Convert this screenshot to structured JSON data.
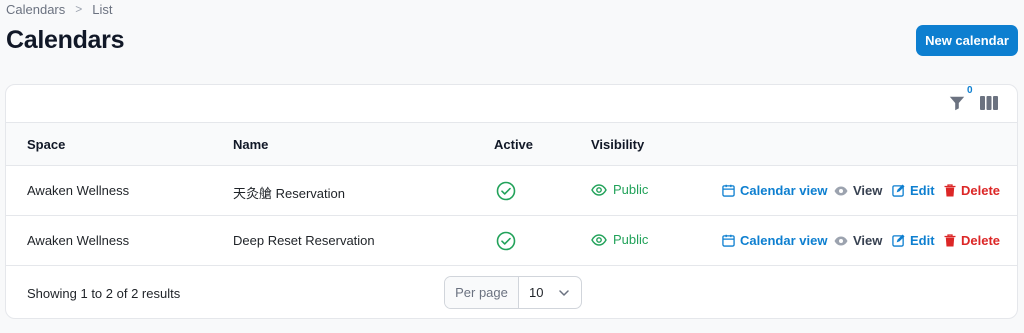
{
  "breadcrumb": {
    "items": [
      "Calendars",
      "List"
    ]
  },
  "page": {
    "title": "Calendars"
  },
  "header": {
    "new_button_label": "New calendar"
  },
  "toolbar": {
    "filter_count": "0",
    "icons": [
      "filter-icon",
      "columns-icon"
    ]
  },
  "table": {
    "headers": [
      "Space",
      "Name",
      "Active",
      "Visibility"
    ],
    "rows": [
      {
        "space": "Awaken Wellness",
        "name": "天灸艙 Reservation",
        "active": true,
        "visibility": "Public",
        "actions": [
          "Calendar view",
          "View",
          "Edit",
          "Delete"
        ]
      },
      {
        "space": "Awaken Wellness",
        "name": "Deep Reset Reservation",
        "active": true,
        "visibility": "Public",
        "actions": [
          "Calendar view",
          "View",
          "Edit",
          "Delete"
        ]
      }
    ]
  },
  "footer": {
    "showing_text": "Showing 1 to 2 of 2 results",
    "per_page_label": "Per page",
    "per_page_value": "10"
  },
  "colors": {
    "primary": "#0d7fd0",
    "success": "#22a25a",
    "danger": "#dc2626",
    "neutral": "#374151"
  }
}
